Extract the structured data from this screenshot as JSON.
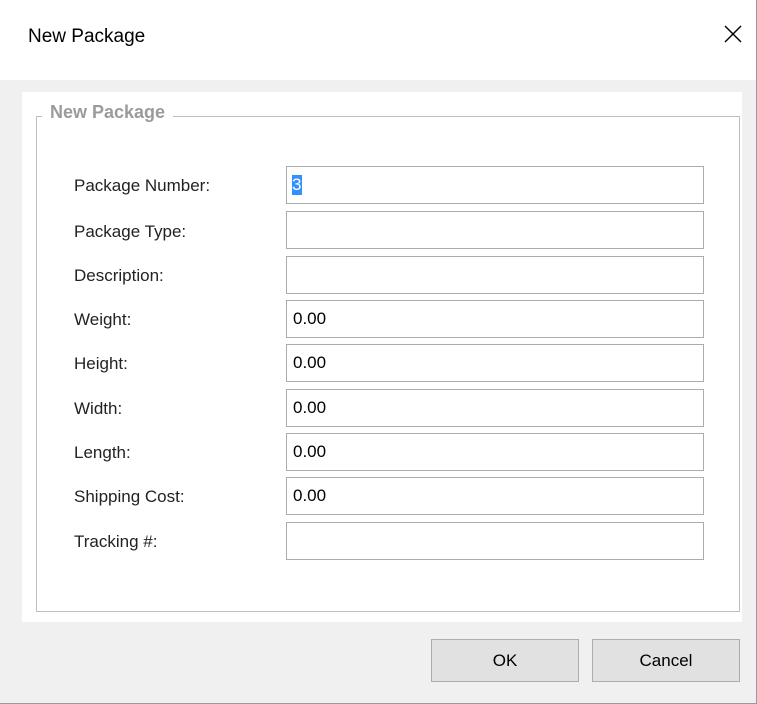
{
  "window": {
    "title": "New Package",
    "close_icon": "close-icon"
  },
  "group": {
    "legend": "New Package"
  },
  "fields": [
    {
      "label": "Package Number:",
      "value": "3",
      "selected": true
    },
    {
      "label": "Package Type:",
      "value": ""
    },
    {
      "label": "Description:",
      "value": ""
    },
    {
      "label": "Weight:",
      "value": "0.00"
    },
    {
      "label": "Height:",
      "value": "0.00"
    },
    {
      "label": "Width:",
      "value": "0.00"
    },
    {
      "label": "Length:",
      "value": "0.00"
    },
    {
      "label": "Shipping Cost:",
      "value": "0.00"
    },
    {
      "label": "Tracking #:",
      "value": ""
    }
  ],
  "buttons": {
    "ok": "OK",
    "cancel": "Cancel"
  },
  "colors": {
    "selection": "#3390ff",
    "legend_text": "#9b9b9b",
    "button_bg": "#e1e1e1"
  }
}
